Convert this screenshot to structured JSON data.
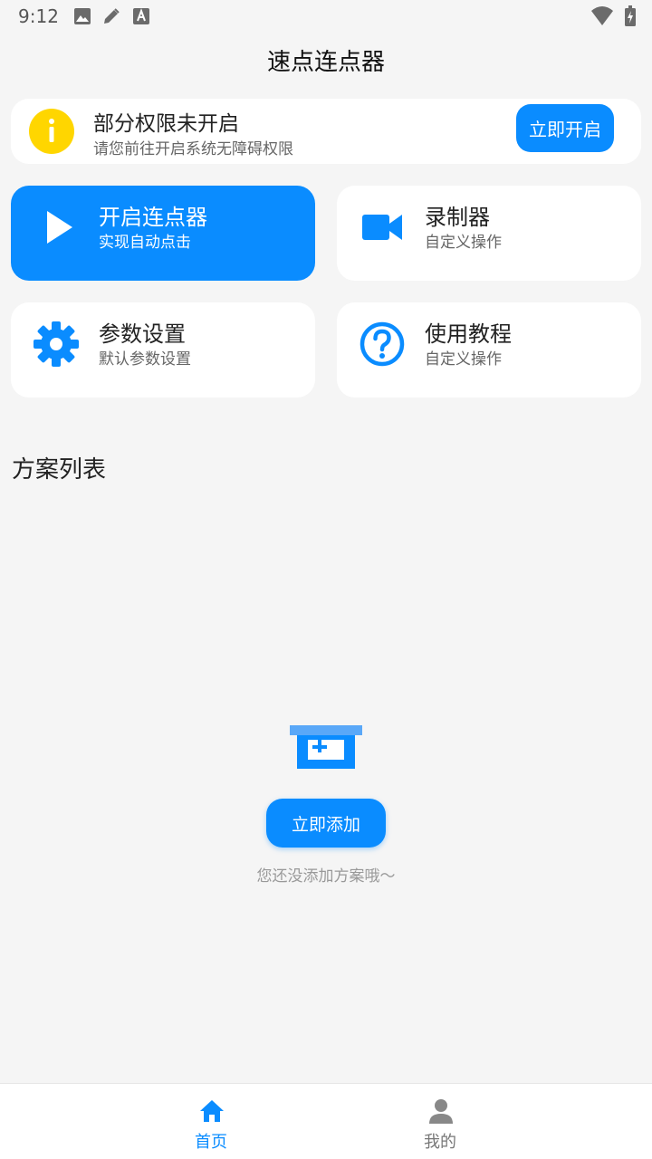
{
  "status_bar": {
    "time": "9:12",
    "icons_left": [
      "image-icon",
      "pencil-icon",
      "font-icon"
    ],
    "icons_right": [
      "wifi-icon",
      "battery-icon"
    ]
  },
  "app_bar": {
    "title": "速点连点器"
  },
  "permission_banner": {
    "icon": "info-icon",
    "title": "部分权限未开启",
    "subtitle": "请您前往开启系统无障碍权限",
    "button_label": "立即开启"
  },
  "cards": [
    {
      "icon": "play-icon",
      "title": "开启连点器",
      "subtitle": "实现自动点击",
      "active": true
    },
    {
      "icon": "video-camera-icon",
      "title": "录制器",
      "subtitle": "自定义操作",
      "active": false
    },
    {
      "icon": "gear-icon",
      "title": "参数设置",
      "subtitle": "默认参数设置",
      "active": false
    },
    {
      "icon": "help-icon",
      "title": "使用教程",
      "subtitle": "自定义操作",
      "active": false
    }
  ],
  "section": {
    "title": "方案列表"
  },
  "empty_state": {
    "icon": "empty-box-icon",
    "button_label": "立即添加",
    "hint": "您还没添加方案哦～"
  },
  "bottom_nav": {
    "items": [
      {
        "icon": "home-icon",
        "label": "首页",
        "active": true
      },
      {
        "icon": "person-icon",
        "label": "我的",
        "active": false
      }
    ]
  },
  "colors": {
    "accent": "#0a8cff",
    "warning": "#ffd600",
    "background": "#f5f5f5",
    "surface": "#ffffff"
  }
}
